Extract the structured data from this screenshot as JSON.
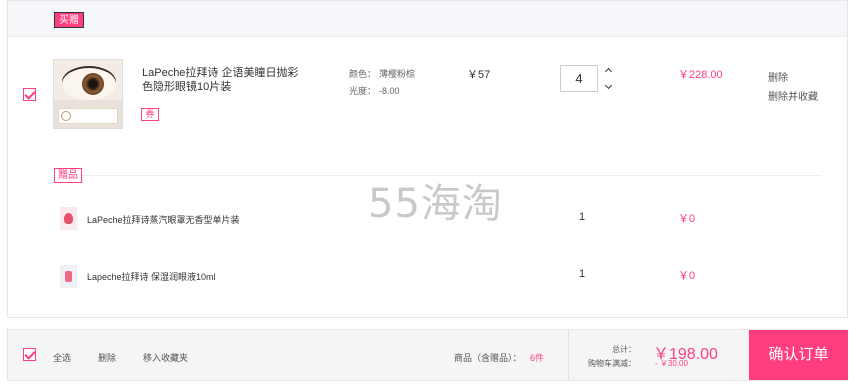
{
  "colors": {
    "accent": "#ff3d7f",
    "header_bg": "#f5f6fa",
    "footer_bg": "#f5f5f5"
  },
  "section": {
    "buy_tag": "买赠",
    "gift_tag": "赠品"
  },
  "main_item": {
    "checked": true,
    "image": "contact-lens-product-image",
    "title": "LaPeche拉拜诗 企语美瞳日抛彩色隐形眼镜10片装",
    "coupon": "券",
    "color_label": "颜色：",
    "color_value": "薄樱粉棕",
    "power_label": "光度：",
    "power_value": "-8.00",
    "unit_price": "￥57",
    "quantity": "4",
    "subtotal": "￥228.00",
    "delete": "删除",
    "delete_and_save": "删除并收藏"
  },
  "gifts": [
    {
      "name": "LaPeche拉拜诗蒸汽眼罩无香型单片装",
      "quantity": "1",
      "subtotal": "￥0",
      "icon": "eye-mask-icon"
    },
    {
      "name": "Lapeche拉拜诗 保湿润眼液10ml",
      "quantity": "1",
      "subtotal": "￥0",
      "icon": "eye-drops-icon"
    }
  ],
  "watermark": "55海淘",
  "footer": {
    "select_all_checked": true,
    "select_all": "全选",
    "delete": "删除",
    "move_to_favorites": "移入收藏夹",
    "items_label": "商品（含赠品）：",
    "items_count": "6件",
    "total_label": "总计：",
    "total_value": "￥198.00",
    "discount_label": "购物车满减：",
    "discount_value": "- ￥30.00",
    "confirm_button": "确认订单"
  }
}
